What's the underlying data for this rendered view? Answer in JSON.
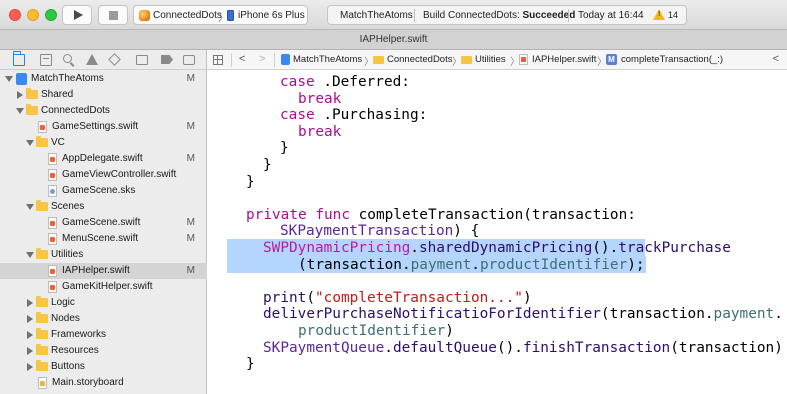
{
  "toolbar": {
    "scheme_target": "ConnectedDots",
    "scheme_device": "iPhone 6s Plus",
    "activity_project": "MatchTheAtoms",
    "activity_build_prefix": "Build ConnectedDots: ",
    "activity_build_status": "Succeeded",
    "activity_time": "Today at 16:44",
    "warning_count": "14",
    "warning_mark": "!"
  },
  "tab": {
    "title": "IAPHelper.swift"
  },
  "navigator": {
    "items": [
      {
        "label": "MatchTheAtoms",
        "badge": "M"
      },
      {
        "label": "Shared",
        "badge": ""
      },
      {
        "label": "ConnectedDots",
        "badge": ""
      },
      {
        "label": "GameSettings.swift",
        "badge": "M"
      },
      {
        "label": "VC",
        "badge": ""
      },
      {
        "label": "AppDelegate.swift",
        "badge": "M"
      },
      {
        "label": "GameViewController.swift",
        "badge": ""
      },
      {
        "label": "GameScene.sks",
        "badge": ""
      },
      {
        "label": "Scenes",
        "badge": ""
      },
      {
        "label": "GameScene.swift",
        "badge": "M"
      },
      {
        "label": "MenuScene.swift",
        "badge": "M"
      },
      {
        "label": "Utilities",
        "badge": ""
      },
      {
        "label": "IAPHelper.swift",
        "badge": "M"
      },
      {
        "label": "GameKitHelper.swift",
        "badge": ""
      },
      {
        "label": "Logic",
        "badge": ""
      },
      {
        "label": "Nodes",
        "badge": ""
      },
      {
        "label": "Frameworks",
        "badge": ""
      },
      {
        "label": "Resources",
        "badge": ""
      },
      {
        "label": "Buttons",
        "badge": ""
      },
      {
        "label": "Main.storyboard",
        "badge": ""
      }
    ]
  },
  "jumpbar": {
    "back": "<",
    "forward": ">",
    "right": "<",
    "sep": "〉",
    "crumbs": [
      "MatchTheAtoms",
      "ConnectedDots",
      "Utilities",
      "IAPHelper.swift",
      "completeTransaction(_:)"
    ],
    "method_icon_letter": "M"
  },
  "code": {
    "l1_case": "case",
    "l1_rest": " .Deferred:",
    "l2": "break",
    "l3_case": "case",
    "l3_rest": " .Purchasing:",
    "l4": "break",
    "brace_close": "}",
    "l8_kw1": "private",
    "l8_kw2": "func",
    "l8_rest": " completeTransaction(transaction:",
    "l9_type": "SKPaymentTransaction",
    "l9_rest": ") {",
    "l10_cls": "SWPDynamicPricing",
    "l10_dot1": ".",
    "l10_m1": "sharedDynamicPricing",
    "l10_p1": "().",
    "l10_m2": "trackPurchase",
    "l11_open": "(transaction.",
    "l11_prop1": "payment",
    "l11_dot": ".",
    "l11_prop2": "productIdentifier",
    "l11_close": ");",
    "l12_fn": "print",
    "l12_open": "(",
    "l12_str": "\"completeTransaction...\"",
    "l12_close": ")",
    "l13_fn": "deliverPurchaseNotificatioForIdentifier",
    "l13_open": "(transaction.",
    "l13_prop": "payment",
    "l13_dot": ".",
    "l14_prop": "productIdentifier",
    "l14_close": ")",
    "l15_type": "SKPaymentQueue",
    "l15_dot1": ".",
    "l15_m1": "defaultQueue",
    "l15_p1": "().",
    "l15_m2": "finishTransaction",
    "l15_rest": "(transaction)"
  },
  "colors": {
    "keyword": "#aa0d91",
    "type": "#5c2699",
    "method": "#2e0d6e",
    "property": "#3f6e74",
    "string": "#c41a16",
    "class_ref": "#b51ca5",
    "selection": "#b4d5fe"
  }
}
